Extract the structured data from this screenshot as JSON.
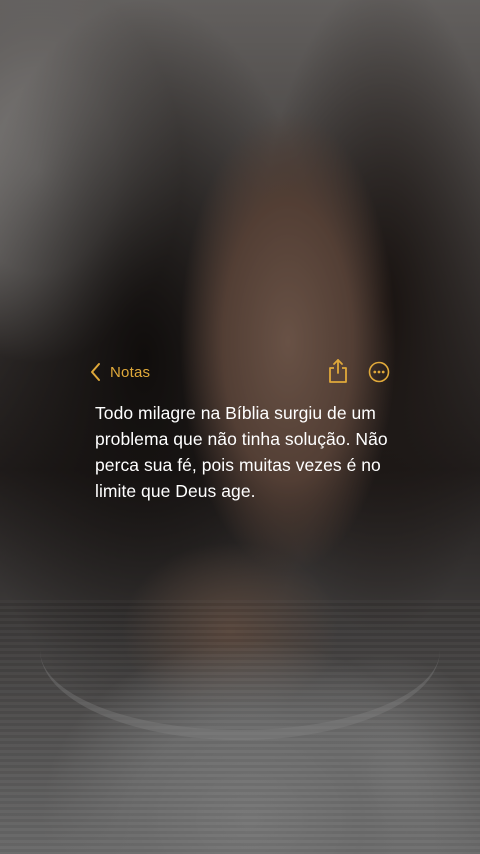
{
  "background": {
    "description_icon": "portrait-photo"
  },
  "header": {
    "back_label": "Notas",
    "back_icon": "chevron-left-icon",
    "share_icon": "share-icon",
    "more_icon": "ellipsis-circle-icon",
    "accent_color": "#e0a93a"
  },
  "note": {
    "text": "Todo milagre na Bíblia surgiu de um problema que não tinha solução. Não perca sua fé, pois muitas vezes é no limite que Deus age."
  }
}
